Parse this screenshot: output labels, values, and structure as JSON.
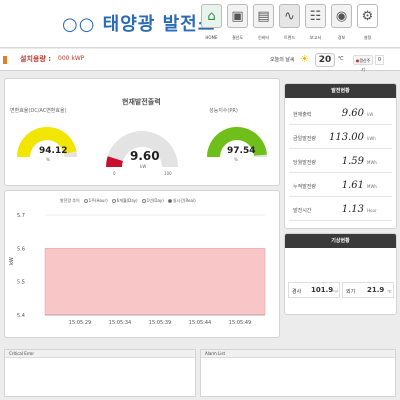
{
  "header": {
    "title": "○○ 태양광 발전소",
    "nav": [
      {
        "label": "HOME",
        "icon": "home-icon"
      },
      {
        "label": "결선도",
        "icon": "wiring-icon"
      },
      {
        "label": "인버터",
        "icon": "inverter-icon"
      },
      {
        "label": "트렌드",
        "icon": "trend-icon"
      },
      {
        "label": "보고서",
        "icon": "report-icon"
      },
      {
        "label": "경보",
        "icon": "alarm-icon"
      },
      {
        "label": "설정",
        "icon": "settings-icon"
      }
    ]
  },
  "subheader": {
    "capacity_label": "설치용량 :",
    "capacity_value": "000 kWP",
    "weather_label": "오늘의 날씨",
    "temperature": "20",
    "temp_unit": "℃",
    "refresh_label": "갱신주기",
    "refresh_value": "0"
  },
  "gauges": [
    {
      "label": "변환효율(DC/AC변환효율)",
      "value": "94.12",
      "unit": "%",
      "fraction": 0.9412,
      "color": "#f2e500"
    },
    {
      "label": "현재발전출력",
      "value": "9.60",
      "unit": "kW",
      "min": "0",
      "max": "100",
      "fraction": 0.096,
      "color": "#c8102e"
    },
    {
      "label": "성능지수(PR)",
      "value": "97.54",
      "unit": "%",
      "fraction": 0.9754,
      "color": "#6fbf1a"
    }
  ],
  "metrics": {
    "header": "발전현황",
    "rows": [
      {
        "label": "현재출력",
        "value": "9.60",
        "unit": "kW"
      },
      {
        "label": "금일발전량",
        "value": "113.00",
        "unit": "kWh"
      },
      {
        "label": "당월발전량",
        "value": "1.59",
        "unit": "MWh"
      },
      {
        "label": "누적발전량",
        "value": "1.61",
        "unit": "MWh"
      },
      {
        "label": "발전시간",
        "value": "1.13",
        "unit": "Hour"
      }
    ]
  },
  "weather": {
    "header": "기상현황",
    "items": [
      {
        "label": "경사",
        "value": "101.9",
        "unit": "W/㎡"
      },
      {
        "label": "외기",
        "value": "21.9",
        "unit": "℃"
      }
    ]
  },
  "chart": {
    "legend_title": "발전량 추이",
    "legend_options": [
      "1주(Hour)",
      "6개월(Day)",
      "1년(Day)",
      "실시간(Real)"
    ],
    "selected_option": "실시간(Real)"
  },
  "chart_data": {
    "type": "area",
    "ylabel": "kW",
    "ylim": [
      5.4,
      5.7
    ],
    "yticks": [
      "5.7",
      "5.6",
      "5.5",
      "5.4"
    ],
    "x": [
      "15:05:29",
      "15:05:34",
      "15:05:39",
      "15:05:44",
      "15:05:49"
    ],
    "series": [
      {
        "values": [
          5.6,
          5.6,
          5.6,
          5.6,
          5.6
        ]
      }
    ],
    "fill": "#f8c6c6"
  },
  "alarms": {
    "critical_label": "Critical Error",
    "alarm_label": "Alarm List"
  }
}
